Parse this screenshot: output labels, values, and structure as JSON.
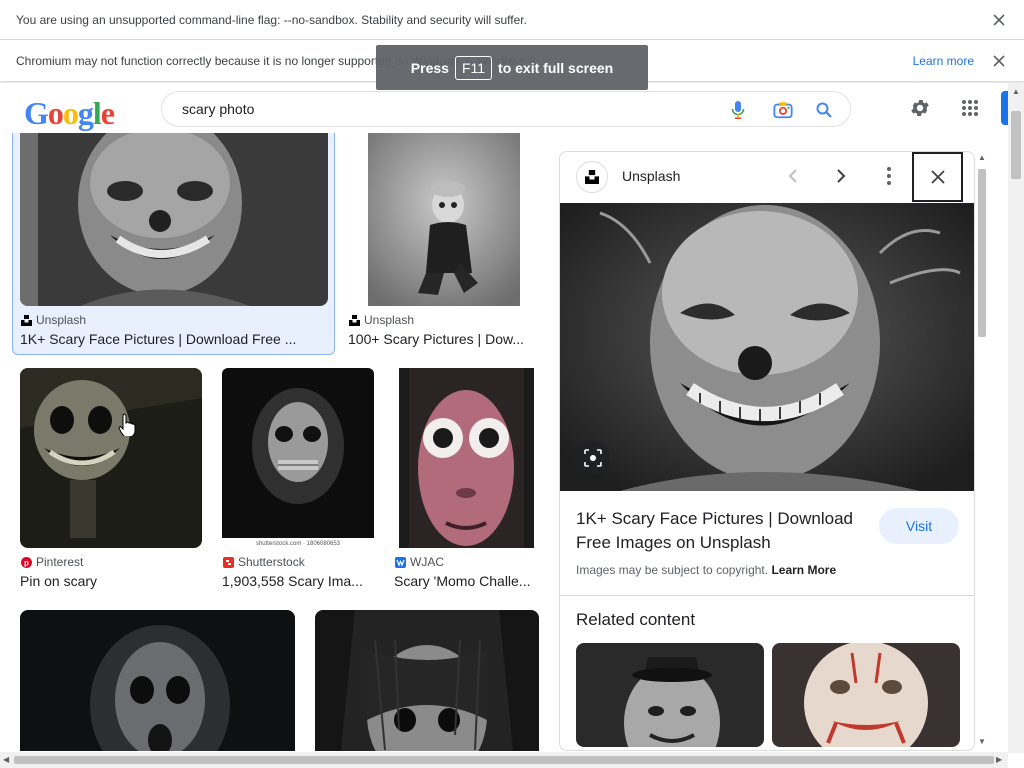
{
  "infobars": {
    "sandbox_message": "You are using an unsupported command-line flag: --no-sandbox. Stability and security will suffer.",
    "chromium_message": "Chromium may not function correctly because it is no longer supported on Windows 7. Windows 8...",
    "learn_more": "Learn more"
  },
  "toast": {
    "press": "Press",
    "key": "F11",
    "suffix": "to exit full screen"
  },
  "header": {
    "logo_letters": [
      "G",
      "o",
      "o",
      "g",
      "l",
      "e"
    ],
    "logo_colors": [
      "#4285f4",
      "#ea4335",
      "#fbbc05",
      "#4285f4",
      "#34a853",
      "#ea4335"
    ],
    "search_query": "scary photo"
  },
  "results": [
    {
      "source": "Unsplash",
      "title": "1K+ Scary Face Pictures | Download Free ..."
    },
    {
      "source": "Unsplash",
      "title": "100+ Scary Pictures | Dow..."
    },
    {
      "source": "Pinterest",
      "title": "Pin on scary"
    },
    {
      "source": "Shutterstock",
      "title": "1,903,558 Scary Ima...",
      "watermark": "shutterstock.com · 1806080653"
    },
    {
      "source": "WJAC",
      "title": "Scary 'Momo Challe..."
    }
  ],
  "panel": {
    "source": "Unsplash",
    "title": "1K+ Scary Face Pictures | Download Free Images on Unsplash",
    "visit": "Visit",
    "copyright": "Images may be subject to copyright.",
    "learn_more": "Learn More",
    "related": "Related content"
  },
  "colors": {
    "accent": "#1a73e8",
    "selected_bg": "#e8f0fe",
    "pinterest": "#e60023",
    "shutterstock": "#ee2b24",
    "wjac": "#1a73e8"
  }
}
